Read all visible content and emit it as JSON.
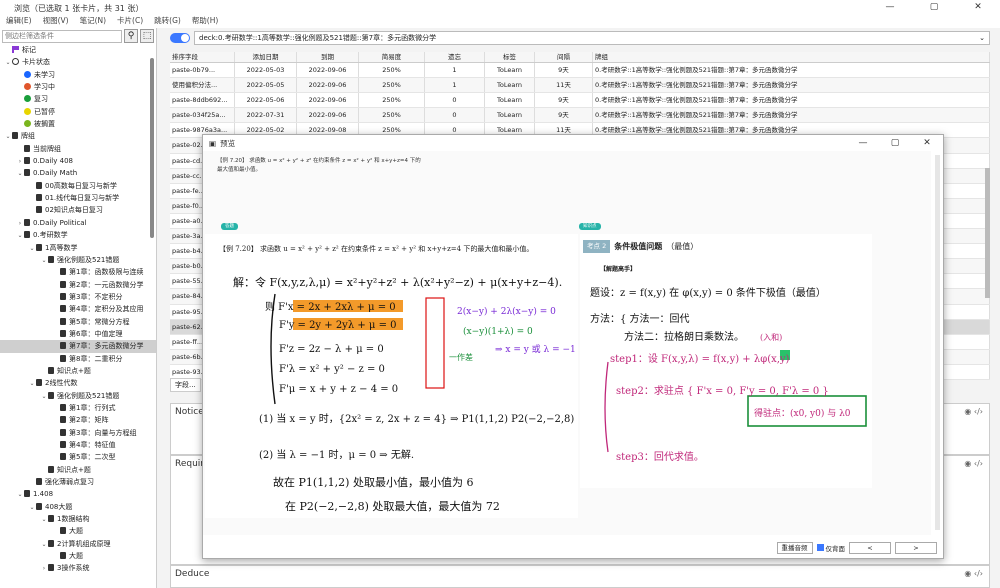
{
  "window": {
    "title": "浏览（已选取 1 张卡片，共 31 张）"
  },
  "menu": [
    "编辑(E)",
    "视图(V)",
    "笔记(N)",
    "卡片(C)",
    "跳转(G)",
    "帮助(H)"
  ],
  "sidebar": {
    "filter_placeholder": "侧边栏筛选条件",
    "tree": [
      {
        "label": "标记",
        "indent": 0,
        "arrow": "",
        "icon": "flag",
        "color": "#8a3ad6"
      },
      {
        "label": "卡片状态",
        "indent": 0,
        "arrow": "v",
        "icon": "circle",
        "color": "#333333"
      },
      {
        "label": "未学习",
        "indent": 1,
        "arrow": "",
        "icon": "dot",
        "color": "#1a66ff"
      },
      {
        "label": "学习中",
        "indent": 1,
        "arrow": "",
        "icon": "dot",
        "color": "#e0562c"
      },
      {
        "label": "复习",
        "indent": 1,
        "arrow": "",
        "icon": "dot",
        "color": "#1a9e3b"
      },
      {
        "label": "已暂停",
        "indent": 1,
        "arrow": "",
        "icon": "dot",
        "color": "#e8d500"
      },
      {
        "label": "被搁置",
        "indent": 1,
        "arrow": "",
        "icon": "dot",
        "color": "#7ab51d"
      },
      {
        "label": "牌组",
        "indent": 0,
        "arrow": "v",
        "icon": "deck",
        "color": "#333333"
      },
      {
        "label": "当前牌组",
        "indent": 1,
        "arrow": "",
        "icon": "deck",
        "color": "#333333"
      },
      {
        "label": "0.Daily 408",
        "indent": 1,
        "arrow": ">",
        "icon": "deck",
        "color": "#333333"
      },
      {
        "label": "0.Daily Math",
        "indent": 1,
        "arrow": "v",
        "icon": "deck",
        "color": "#333333"
      },
      {
        "label": "00高数每日复习与新学",
        "indent": 2,
        "arrow": "",
        "icon": "deck",
        "color": "#333333"
      },
      {
        "label": "01.线代每日复习与新学",
        "indent": 2,
        "arrow": "",
        "icon": "deck",
        "color": "#333333"
      },
      {
        "label": "02知识点每日复习",
        "indent": 2,
        "arrow": "",
        "icon": "deck",
        "color": "#333333"
      },
      {
        "label": "0.Daily Political",
        "indent": 1,
        "arrow": ">",
        "icon": "deck",
        "color": "#333333"
      },
      {
        "label": "0.考研数学",
        "indent": 1,
        "arrow": "v",
        "icon": "deck",
        "color": "#333333"
      },
      {
        "label": "1高等数学",
        "indent": 2,
        "arrow": "v",
        "icon": "deck",
        "color": "#333333"
      },
      {
        "label": "强化例题及521错题",
        "indent": 3,
        "arrow": "v",
        "icon": "deck",
        "color": "#333333"
      },
      {
        "label": "第1章：函数极限与连续",
        "indent": 4,
        "arrow": "",
        "icon": "deck",
        "color": "#333333"
      },
      {
        "label": "第2章：一元函数微分学",
        "indent": 4,
        "arrow": "",
        "icon": "deck",
        "color": "#333333"
      },
      {
        "label": "第3章：不定积分",
        "indent": 4,
        "arrow": "",
        "icon": "deck",
        "color": "#333333"
      },
      {
        "label": "第4章：定积分及其应用",
        "indent": 4,
        "arrow": "",
        "icon": "deck",
        "color": "#333333"
      },
      {
        "label": "第5章：常微分方程",
        "indent": 4,
        "arrow": "",
        "icon": "deck",
        "color": "#333333"
      },
      {
        "label": "第6章：中值定理",
        "indent": 4,
        "arrow": "",
        "icon": "deck",
        "color": "#333333"
      },
      {
        "label": "第7章：多元函数微分学",
        "indent": 4,
        "arrow": "",
        "icon": "deck",
        "color": "#333333",
        "selected": true
      },
      {
        "label": "第8章：二重积分",
        "indent": 4,
        "arrow": "",
        "icon": "deck",
        "color": "#333333"
      },
      {
        "label": "知识点+题",
        "indent": 3,
        "arrow": "",
        "icon": "deck",
        "color": "#333333"
      },
      {
        "label": "2线性代数",
        "indent": 2,
        "arrow": "v",
        "icon": "deck",
        "color": "#333333"
      },
      {
        "label": "强化例题及521错题",
        "indent": 3,
        "arrow": "v",
        "icon": "deck",
        "color": "#333333"
      },
      {
        "label": "第1章：行列式",
        "indent": 4,
        "arrow": "",
        "icon": "deck",
        "color": "#333333"
      },
      {
        "label": "第2章：矩阵",
        "indent": 4,
        "arrow": "",
        "icon": "deck",
        "color": "#333333"
      },
      {
        "label": "第3章：向量与方程组",
        "indent": 4,
        "arrow": "",
        "icon": "deck",
        "color": "#333333"
      },
      {
        "label": "第4章：特征值",
        "indent": 4,
        "arrow": "",
        "icon": "deck",
        "color": "#333333"
      },
      {
        "label": "第5章：二次型",
        "indent": 4,
        "arrow": "",
        "icon": "deck",
        "color": "#333333"
      },
      {
        "label": "知识点+题",
        "indent": 3,
        "arrow": "",
        "icon": "deck",
        "color": "#333333"
      },
      {
        "label": "强化薄弱点复习",
        "indent": 2,
        "arrow": "",
        "icon": "deck",
        "color": "#333333"
      },
      {
        "label": "1.408",
        "indent": 1,
        "arrow": "v",
        "icon": "deck",
        "color": "#333333"
      },
      {
        "label": "408大题",
        "indent": 2,
        "arrow": "v",
        "icon": "deck",
        "color": "#333333"
      },
      {
        "label": "1数据结构",
        "indent": 3,
        "arrow": "v",
        "icon": "deck",
        "color": "#333333"
      },
      {
        "label": "大题",
        "indent": 4,
        "arrow": "",
        "icon": "deck",
        "color": "#333333"
      },
      {
        "label": "2计算机组成原理",
        "indent": 3,
        "arrow": "v",
        "icon": "deck",
        "color": "#333333"
      },
      {
        "label": "大题",
        "indent": 4,
        "arrow": "",
        "icon": "deck",
        "color": "#333333"
      },
      {
        "label": "3操作系统",
        "indent": 3,
        "arrow": ">",
        "icon": "deck",
        "color": "#333333"
      }
    ]
  },
  "search": {
    "query": "deck:0.考研数学::1高等数学::强化例题及521错题::第7章：多元函数微分学"
  },
  "table": {
    "columns": [
      "排序字段",
      "添加日期",
      "到期",
      "简易度",
      "遗忘",
      "标签",
      "间隔",
      "牌组"
    ],
    "rows": [
      {
        "cells": [
          "paste-0b79...",
          "2022-05-03",
          "2022-09-06",
          "250%",
          "1",
          "ToLearn",
          "9天",
          "0.考研数学::1高等数学::强化例题及521错题::第7章：多元函数微分学"
        ]
      },
      {
        "cells": [
          "使用偏积分法...",
          "2022-05-05",
          "2022-09-06",
          "250%",
          "1",
          "ToLearn",
          "11天",
          "0.考研数学::1高等数学::强化例题及521错题::第7章：多元函数微分学"
        ]
      },
      {
        "cells": [
          "paste-8ddb692...",
          "2022-05-06",
          "2022-09-06",
          "250%",
          "0",
          "ToLearn",
          "9天",
          "0.考研数学::1高等数学::强化例题及521错题::第7章：多元函数微分学"
        ]
      },
      {
        "cells": [
          "paste-034f25a...",
          "2022-07-31",
          "2022-09-06",
          "250%",
          "0",
          "ToLearn",
          "9天",
          "0.考研数学::1高等数学::强化例题及521错题::第7章：多元函数微分学"
        ]
      },
      {
        "cells": [
          "paste-9876a3a...",
          "2022-05-02",
          "2022-09-08",
          "250%",
          "0",
          "ToLearn",
          "11天",
          "0.考研数学::1高等数学::强化例题及521错题::第7章：多元函数微分学"
        ]
      },
      {
        "cells": [
          "paste-02...",
          "",
          "",
          "",
          "",
          "",
          "",
          ""
        ]
      },
      {
        "cells": [
          "paste-cd...",
          "",
          "",
          "",
          "",
          "",
          "",
          ""
        ]
      },
      {
        "cells": [
          "paste-cc...",
          "",
          "",
          "",
          "",
          "",
          "",
          ""
        ]
      },
      {
        "cells": [
          "paste-fe...",
          "",
          "",
          "",
          "",
          "",
          "",
          ""
        ]
      },
      {
        "cells": [
          "paste-f0...",
          "",
          "",
          "",
          "",
          "",
          "",
          ""
        ]
      },
      {
        "cells": [
          "paste-a0...",
          "",
          "",
          "",
          "",
          "",
          "",
          ""
        ]
      },
      {
        "cells": [
          "paste-3a...",
          "",
          "",
          "",
          "",
          "",
          "",
          ""
        ]
      },
      {
        "cells": [
          "paste-b4...",
          "",
          "",
          "",
          "",
          "",
          "",
          ""
        ]
      },
      {
        "cells": [
          "paste-b0...",
          "",
          "",
          "",
          "",
          "",
          "",
          ""
        ]
      },
      {
        "cells": [
          "paste-55...",
          "",
          "",
          "",
          "",
          "",
          "",
          ""
        ]
      },
      {
        "cells": [
          "paste-84...",
          "",
          "",
          "",
          "",
          "",
          "",
          ""
        ]
      },
      {
        "cells": [
          "paste-95...",
          "",
          "",
          "",
          "",
          "",
          "",
          ""
        ]
      },
      {
        "cells": [
          "paste-62...",
          "",
          "",
          "",
          "",
          "",
          "",
          ""
        ],
        "selected": true
      },
      {
        "cells": [
          "paste-ff...",
          "",
          "",
          "",
          "",
          "",
          "",
          ""
        ]
      },
      {
        "cells": [
          "paste-6b...",
          "",
          "",
          "",
          "",
          "",
          "",
          ""
        ]
      },
      {
        "cells": [
          "paste-93...",
          "",
          "",
          "",
          "",
          "",
          "",
          ""
        ]
      }
    ]
  },
  "editor": {
    "field_tab": "字段...",
    "fields": [
      "Notice",
      "Required",
      "Deduce"
    ]
  },
  "preview": {
    "title": "预览",
    "question_top": "【例 7.20】 求函数 u = x² + y² + z² 在约束条件 z = x² + y² 和 x+y+z=4 下的最大值和最小值。",
    "tag_left": "答题",
    "tag_right": "知识点",
    "left_question": "【例 7.20】 求函数 u = x² + y² + z² 在约束条件 z = x² + y² 和 x+y+z=4 下的最大值和最小值。",
    "kp_label": "考点 2",
    "kp_title": "条件极值问题",
    "kp_note": "（最值）",
    "kp_sub": "【解题高手】",
    "left_lines": [
      "解：令 F(x,y,z,λ,μ) = x²+y²+z² + λ(x²+y²−z) + μ(x+y+z−4).",
      "则 F'x = 2x + 2xλ + μ = 0",
      "F'y = 2y + 2yλ + μ = 0",
      "F'z = 2z − λ + μ = 0",
      "F'λ = x² + y² − z = 0",
      "F'μ = x + y + z − 4 = 0",
      "(1) 当 x = y 时，{2x² = z, 2x + z = 4} ⇒ P1(1,1,2)   P2(−2,−2,8)",
      "(2) 当 λ = −1 时，μ = 0 ⇒ 无解.",
      "故在 P1(1,1,2) 处取最小值，最小值为 6",
      "在 P2(−2,−2,8) 处取最大值，最大值为 72"
    ],
    "left_side": "2(x−y) + 2λ(x−y) = 0",
    "left_side2": "(x−y)(1+λ) = 0",
    "left_side3": "⇒ x = y 或 λ = −1",
    "left_side4": "一作差",
    "right_lines": [
      "题设：z = f(x,y) 在 φ(x,y) = 0 条件下极值（最值）",
      "方法：{ 方法一：回代",
      "方法二：拉格朗日乘数法。",
      "step1：设 F(x,y,λ) = f(x,y) + λφ(x,y)",
      "step2：求驻点 { F'x = 0, F'y = 0, F'λ = 0 }",
      "得驻点：(x0, y0) 与 λ0",
      "step3：回代求值。",
      "(入和)"
    ],
    "footer": {
      "replay": "重播音频",
      "back_only": "仅背面",
      "prev": "<",
      "next": ">"
    }
  }
}
